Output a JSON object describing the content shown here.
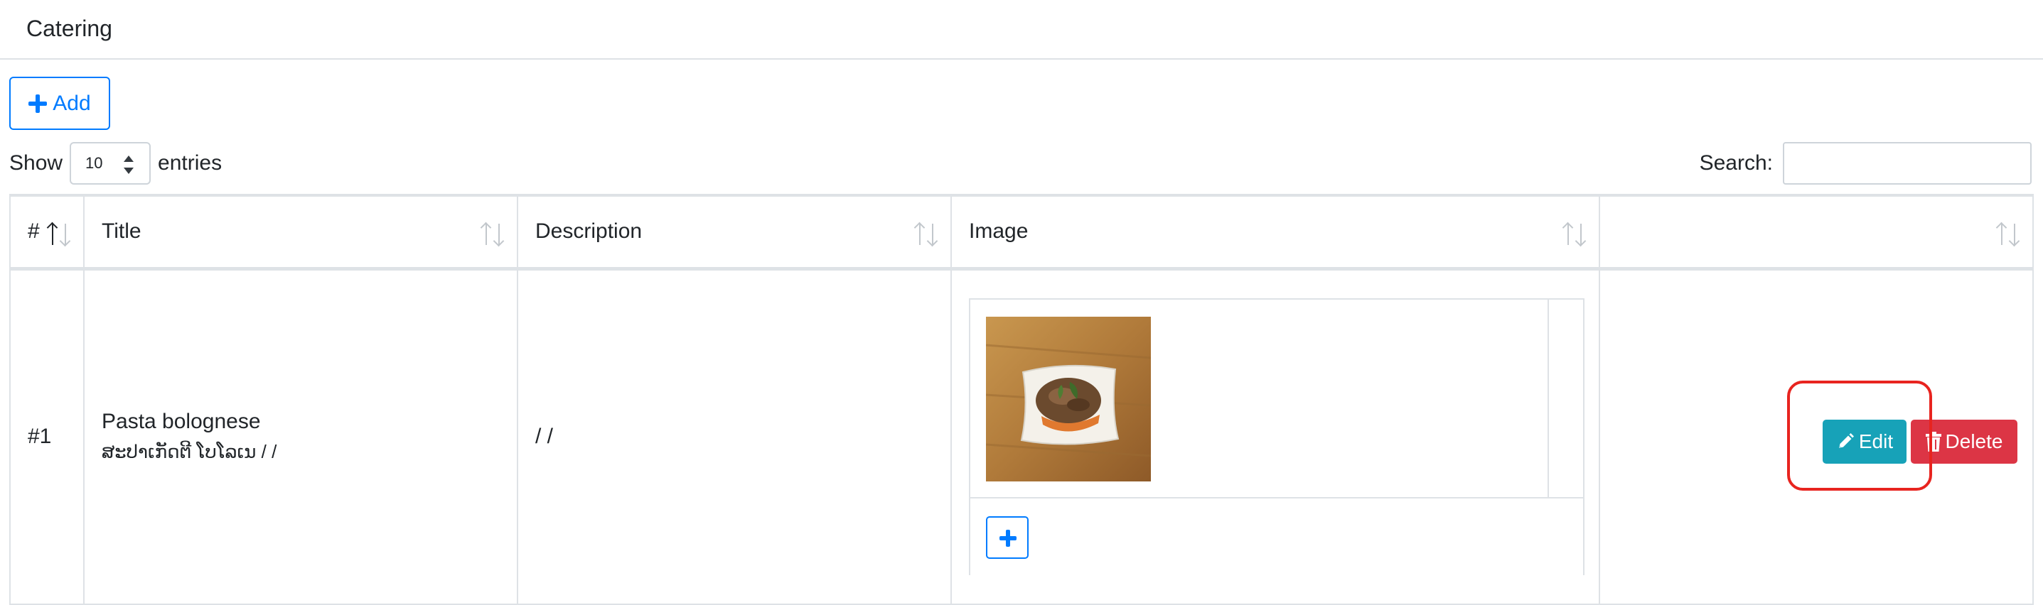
{
  "header": {
    "title": "Catering"
  },
  "toolbar": {
    "add_label": "Add"
  },
  "length": {
    "prefix": "Show",
    "value": "10",
    "suffix": "entries"
  },
  "search": {
    "label": "Search:",
    "value": "",
    "placeholder": ""
  },
  "table": {
    "columns": [
      "#",
      "Title",
      "Description",
      "Image",
      ""
    ],
    "rows": [
      {
        "id": "#1",
        "title": "Pasta bolognese",
        "title_sub": "ສະປາເກັດຕີ ໂບໂລເນ / /",
        "description": "/ /",
        "image_alt": "pasta-bolognese-photo"
      }
    ]
  },
  "actions": {
    "edit_label": "Edit",
    "delete_label": "Delete"
  },
  "colors": {
    "primary": "#007bff",
    "info": "#17a2b8",
    "danger": "#dc3545",
    "highlight": "#e8241f"
  }
}
